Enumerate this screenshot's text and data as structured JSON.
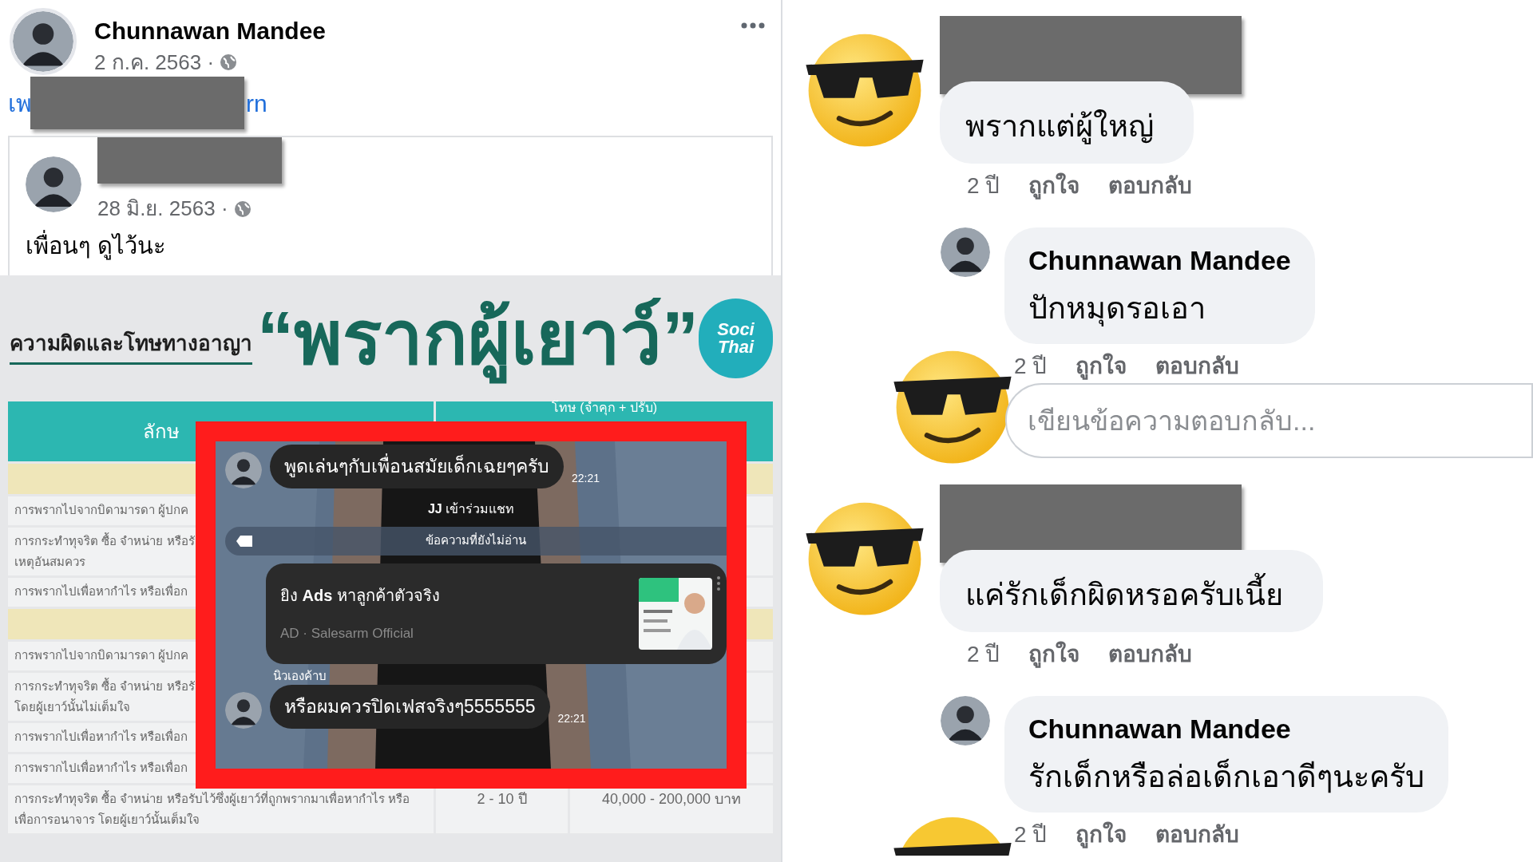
{
  "post": {
    "author": "Chunnawan Mandee",
    "date": "2 ก.ค. 2563 ·",
    "link_fragments": [
      "เพ",
      "rn"
    ],
    "shared": {
      "date": "28 มิ.ย. 2563 ·",
      "text": "เพื่อนๆ ดูไว้นะ"
    },
    "infographic": {
      "subtitle": "ความผิดและโทษทางอาญา",
      "title": "“พรากผู้เยาว์”",
      "logo": [
        "Soci",
        "Thai"
      ],
      "columns": [
        "ลักษ",
        "โทษ (จำคุก + ปรับ)"
      ],
      "rows": [
        {
          "kind": "section"
        },
        {
          "kind": "row",
          "cells": [
            "การพรากไปจากบิดามารดา ผู้ปกค"
          ]
        },
        {
          "kind": "row",
          "cells": [
            "การกระทำทุจริต ซื้อ จำหน่าย หรือรั\nเหตุอันสมควร"
          ]
        },
        {
          "kind": "row",
          "cells": [
            "การพรากไปเพื่อหากำไร หรือเพื่อก"
          ]
        },
        {
          "kind": "section"
        },
        {
          "kind": "row",
          "cells": [
            "การพรากไปจากบิดามารดา ผู้ปกค"
          ]
        },
        {
          "kind": "row",
          "cells": [
            "การกระทำทุจริต ซื้อ จำหน่าย หรือรั\nโดยผู้เยาว์นั้นไม่เต็มใจ"
          ]
        },
        {
          "kind": "row",
          "cells": [
            "การพรากไปเพื่อหากำไร หรือเพื่อก"
          ]
        },
        {
          "kind": "row",
          "cells": [
            "การพรากไปเพื่อหากำไร หรือเพื่อก"
          ]
        },
        {
          "kind": "row",
          "cells": [
            "การกระทำทุจริต ซื้อ จำหน่าย หรือรับไว้ซึ่งผู้เยาว์ที่ถูกพรากมาเพื่อหากำไร หรือ\nเพื่อการอนาจาร โดยผู้เยาว์นั้นเต็มใจ",
            "2 - 10 ปี",
            "40,000 - 200,000 บาท"
          ]
        }
      ]
    },
    "chat": {
      "messages": [
        {
          "kind": "bubble",
          "text": "พูดเล่นๆกับเพื่อนสมัยเด็กเฉยๆครับ",
          "time": "22:21"
        },
        {
          "kind": "system",
          "text": "**JJ** เข้าร่วมแชท"
        },
        {
          "kind": "unread",
          "text": "ข้อความที่ยังไม่อ่าน"
        },
        {
          "kind": "ad",
          "text": "ยิง **Ads** หาลูกค้าตัวจริง",
          "source": "AD · Salesarm Official"
        },
        {
          "kind": "bubble",
          "sender": "นิวเองค้าบ",
          "text": "หรือผมควรปิดเฟสจริงๆ5555555",
          "time": "22:21"
        }
      ]
    }
  },
  "comments": [
    {
      "kind": "comment",
      "text": "พรากแต่ผู้ใหญ่",
      "actions": [
        "2 ปี",
        "ถูกใจ",
        "ตอบกลับ"
      ]
    },
    {
      "kind": "reply",
      "author": "Chunnawan Mandee",
      "text": "ปักหมุดรอเอา",
      "actions": [
        "2 ปี",
        "ถูกใจ",
        "ตอบกลับ"
      ]
    },
    {
      "kind": "reply_input",
      "placeholder": "เขียนข้อความตอบกลับ..."
    },
    {
      "kind": "comment",
      "text": "แค่รักเด็กผิดหรอครับเนี้ย",
      "actions": [
        "2 ปี",
        "ถูกใจ",
        "ตอบกลับ"
      ]
    },
    {
      "kind": "reply",
      "author": "Chunnawan Mandee",
      "text": "รักเด็กหรือล่อเด็กเอาดีๆนะครับ",
      "actions": [
        "2 ปี",
        "ถูกใจ",
        "ตอบกลับ"
      ]
    }
  ]
}
